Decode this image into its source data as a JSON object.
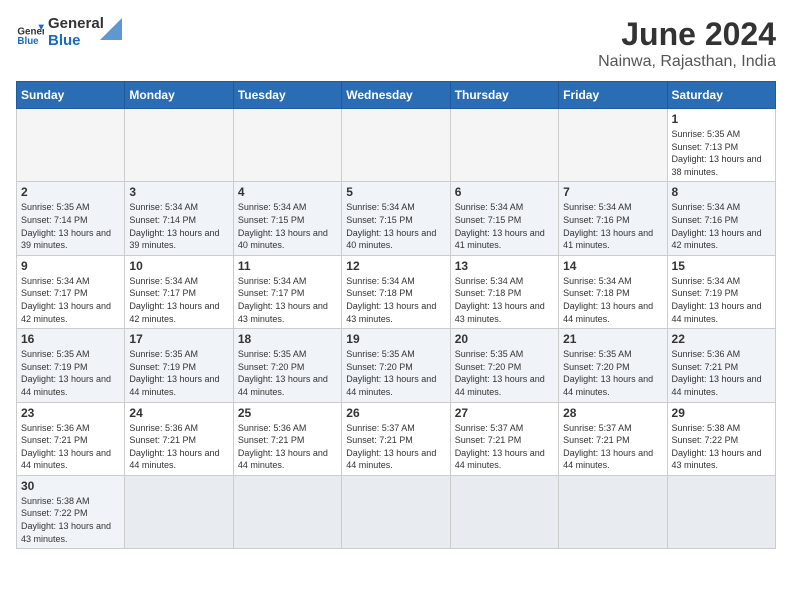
{
  "header": {
    "logo_general": "General",
    "logo_blue": "Blue",
    "month_title": "June 2024",
    "subtitle": "Nainwa, Rajasthan, India"
  },
  "weekdays": [
    "Sunday",
    "Monday",
    "Tuesday",
    "Wednesday",
    "Thursday",
    "Friday",
    "Saturday"
  ],
  "weeks": [
    [
      {
        "day": "",
        "empty": true
      },
      {
        "day": "",
        "empty": true
      },
      {
        "day": "",
        "empty": true
      },
      {
        "day": "",
        "empty": true
      },
      {
        "day": "",
        "empty": true
      },
      {
        "day": "",
        "empty": true
      },
      {
        "day": "1",
        "sunrise": "5:35 AM",
        "sunset": "7:13 PM",
        "daylight": "13 hours and 38 minutes."
      }
    ],
    [
      {
        "day": "2",
        "sunrise": "5:35 AM",
        "sunset": "7:14 PM",
        "daylight": "13 hours and 39 minutes."
      },
      {
        "day": "3",
        "sunrise": "5:34 AM",
        "sunset": "7:14 PM",
        "daylight": "13 hours and 39 minutes."
      },
      {
        "day": "4",
        "sunrise": "5:34 AM",
        "sunset": "7:15 PM",
        "daylight": "13 hours and 40 minutes."
      },
      {
        "day": "5",
        "sunrise": "5:34 AM",
        "sunset": "7:15 PM",
        "daylight": "13 hours and 40 minutes."
      },
      {
        "day": "6",
        "sunrise": "5:34 AM",
        "sunset": "7:15 PM",
        "daylight": "13 hours and 41 minutes."
      },
      {
        "day": "7",
        "sunrise": "5:34 AM",
        "sunset": "7:16 PM",
        "daylight": "13 hours and 41 minutes."
      },
      {
        "day": "8",
        "sunrise": "5:34 AM",
        "sunset": "7:16 PM",
        "daylight": "13 hours and 42 minutes."
      }
    ],
    [
      {
        "day": "9",
        "sunrise": "5:34 AM",
        "sunset": "7:17 PM",
        "daylight": "13 hours and 42 minutes."
      },
      {
        "day": "10",
        "sunrise": "5:34 AM",
        "sunset": "7:17 PM",
        "daylight": "13 hours and 42 minutes."
      },
      {
        "day": "11",
        "sunrise": "5:34 AM",
        "sunset": "7:17 PM",
        "daylight": "13 hours and 43 minutes."
      },
      {
        "day": "12",
        "sunrise": "5:34 AM",
        "sunset": "7:18 PM",
        "daylight": "13 hours and 43 minutes."
      },
      {
        "day": "13",
        "sunrise": "5:34 AM",
        "sunset": "7:18 PM",
        "daylight": "13 hours and 43 minutes."
      },
      {
        "day": "14",
        "sunrise": "5:34 AM",
        "sunset": "7:18 PM",
        "daylight": "13 hours and 44 minutes."
      },
      {
        "day": "15",
        "sunrise": "5:34 AM",
        "sunset": "7:19 PM",
        "daylight": "13 hours and 44 minutes."
      }
    ],
    [
      {
        "day": "16",
        "sunrise": "5:35 AM",
        "sunset": "7:19 PM",
        "daylight": "13 hours and 44 minutes."
      },
      {
        "day": "17",
        "sunrise": "5:35 AM",
        "sunset": "7:19 PM",
        "daylight": "13 hours and 44 minutes."
      },
      {
        "day": "18",
        "sunrise": "5:35 AM",
        "sunset": "7:20 PM",
        "daylight": "13 hours and 44 minutes."
      },
      {
        "day": "19",
        "sunrise": "5:35 AM",
        "sunset": "7:20 PM",
        "daylight": "13 hours and 44 minutes."
      },
      {
        "day": "20",
        "sunrise": "5:35 AM",
        "sunset": "7:20 PM",
        "daylight": "13 hours and 44 minutes."
      },
      {
        "day": "21",
        "sunrise": "5:35 AM",
        "sunset": "7:20 PM",
        "daylight": "13 hours and 44 minutes."
      },
      {
        "day": "22",
        "sunrise": "5:36 AM",
        "sunset": "7:21 PM",
        "daylight": "13 hours and 44 minutes."
      }
    ],
    [
      {
        "day": "23",
        "sunrise": "5:36 AM",
        "sunset": "7:21 PM",
        "daylight": "13 hours and 44 minutes."
      },
      {
        "day": "24",
        "sunrise": "5:36 AM",
        "sunset": "7:21 PM",
        "daylight": "13 hours and 44 minutes."
      },
      {
        "day": "25",
        "sunrise": "5:36 AM",
        "sunset": "7:21 PM",
        "daylight": "13 hours and 44 minutes."
      },
      {
        "day": "26",
        "sunrise": "5:37 AM",
        "sunset": "7:21 PM",
        "daylight": "13 hours and 44 minutes."
      },
      {
        "day": "27",
        "sunrise": "5:37 AM",
        "sunset": "7:21 PM",
        "daylight": "13 hours and 44 minutes."
      },
      {
        "day": "28",
        "sunrise": "5:37 AM",
        "sunset": "7:21 PM",
        "daylight": "13 hours and 44 minutes."
      },
      {
        "day": "29",
        "sunrise": "5:38 AM",
        "sunset": "7:22 PM",
        "daylight": "13 hours and 43 minutes."
      }
    ],
    [
      {
        "day": "30",
        "sunrise": "5:38 AM",
        "sunset": "7:22 PM",
        "daylight": "13 hours and 43 minutes."
      },
      {
        "day": "",
        "empty": true
      },
      {
        "day": "",
        "empty": true
      },
      {
        "day": "",
        "empty": true
      },
      {
        "day": "",
        "empty": true
      },
      {
        "day": "",
        "empty": true
      },
      {
        "day": "",
        "empty": true
      }
    ]
  ]
}
